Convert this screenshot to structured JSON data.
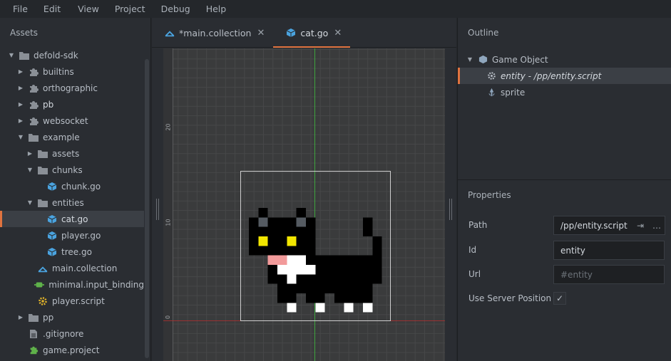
{
  "menu": [
    "File",
    "Edit",
    "View",
    "Project",
    "Debug",
    "Help"
  ],
  "assets": {
    "title": "Assets",
    "tree": [
      {
        "label": "defold-sdk",
        "icon": "folder-icon",
        "caret": "down",
        "indent": 0
      },
      {
        "label": "builtins",
        "icon": "puzzle-icon",
        "caret": "right",
        "indent": 1
      },
      {
        "label": "orthographic",
        "icon": "puzzle-icon",
        "caret": "right",
        "indent": 1
      },
      {
        "label": "pb",
        "icon": "puzzle-icon",
        "caret": "right",
        "indent": 1
      },
      {
        "label": "websocket",
        "icon": "puzzle-icon",
        "caret": "right",
        "indent": 1
      },
      {
        "label": "example",
        "icon": "folder-icon",
        "caret": "down",
        "indent": 1
      },
      {
        "label": "assets",
        "icon": "folder-icon",
        "caret": "right",
        "indent": 2
      },
      {
        "label": "chunks",
        "icon": "folder-icon",
        "caret": "down",
        "indent": 2
      },
      {
        "label": "chunk.go",
        "icon": "cube-icon",
        "caret": "",
        "indent": 3
      },
      {
        "label": "entities",
        "icon": "folder-icon",
        "caret": "down",
        "indent": 2
      },
      {
        "label": "cat.go",
        "icon": "cube-icon",
        "caret": "",
        "indent": 3,
        "selected": true
      },
      {
        "label": "player.go",
        "icon": "cube-icon",
        "caret": "",
        "indent": 3
      },
      {
        "label": "tree.go",
        "icon": "cube-icon",
        "caret": "",
        "indent": 3
      },
      {
        "label": "main.collection",
        "icon": "collection-icon",
        "caret": "",
        "indent": 2
      },
      {
        "label": "minimal.input_binding",
        "icon": "input-binding-icon",
        "caret": "",
        "indent": 2
      },
      {
        "label": "player.script",
        "icon": "script-gear-icon",
        "caret": "",
        "indent": 2
      },
      {
        "label": "pp",
        "icon": "folder-icon",
        "caret": "right",
        "indent": 1
      },
      {
        "label": ".gitignore",
        "icon": "file-icon",
        "caret": "",
        "indent": 1
      },
      {
        "label": "game.project",
        "icon": "project-icon",
        "caret": "",
        "indent": 1
      }
    ]
  },
  "tabs": [
    {
      "label": "*main.collection",
      "icon": "collection-icon",
      "active": false
    },
    {
      "label": "cat.go",
      "icon": "cube-icon",
      "active": true
    }
  ],
  "tab_close_glyph": "✕",
  "ruler": {
    "labels": [
      "20",
      "10",
      "0"
    ]
  },
  "outline": {
    "title": "Outline",
    "items": [
      {
        "label": "Game Object",
        "icon": "cube-icon"
      },
      {
        "label": "entity - /pp/entity.script",
        "icon": "gear-icon"
      },
      {
        "label": "sprite",
        "icon": "sprite-icon"
      }
    ]
  },
  "properties": {
    "title": "Properties",
    "path_label": "Path",
    "path_value": "/pp/entity.script",
    "id_label": "Id",
    "id_value": "entity",
    "url_label": "Url",
    "url_placeholder": "#entity",
    "server_pos_label": "Use Server Position",
    "server_pos_checked": "✓"
  },
  "colors": {
    "accent": "#e0733f",
    "cube": "#4aa3df",
    "panel": "#2a2d32"
  }
}
